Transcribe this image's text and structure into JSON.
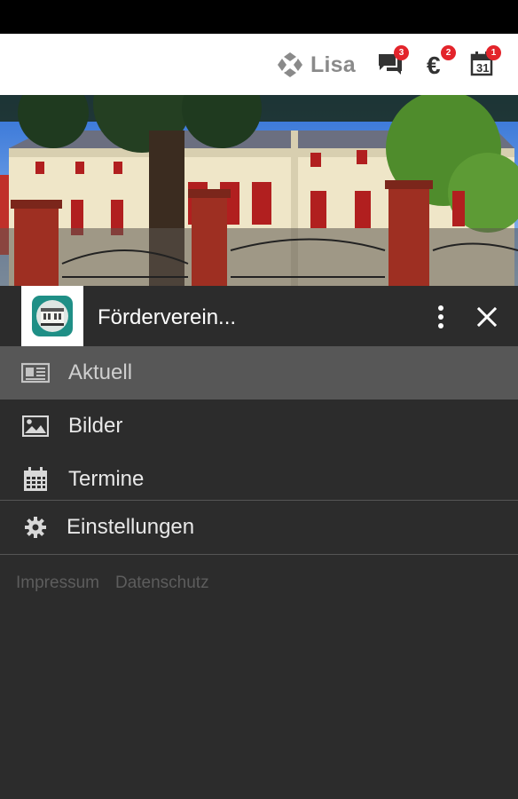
{
  "topbar": {
    "brand_name": "Lisa",
    "messages_badge": "3",
    "payments_badge": "2",
    "calendar_badge": "1",
    "calendar_day": "31"
  },
  "drawer": {
    "club_name": "Förderverein..."
  },
  "menu": {
    "items": [
      {
        "label": "Aktuell",
        "icon": "newspaper-icon",
        "active": true
      },
      {
        "label": "Bilder",
        "icon": "image-icon",
        "active": false
      },
      {
        "label": "Termine",
        "icon": "calendar-icon",
        "active": false
      }
    ],
    "settings_label": "Einstellungen"
  },
  "footer": {
    "impressum": "Impressum",
    "datenschutz": "Datenschutz"
  },
  "colors": {
    "badge": "#e3242b",
    "drawer_bg": "#2c2c2c",
    "active_item": "#575757"
  }
}
